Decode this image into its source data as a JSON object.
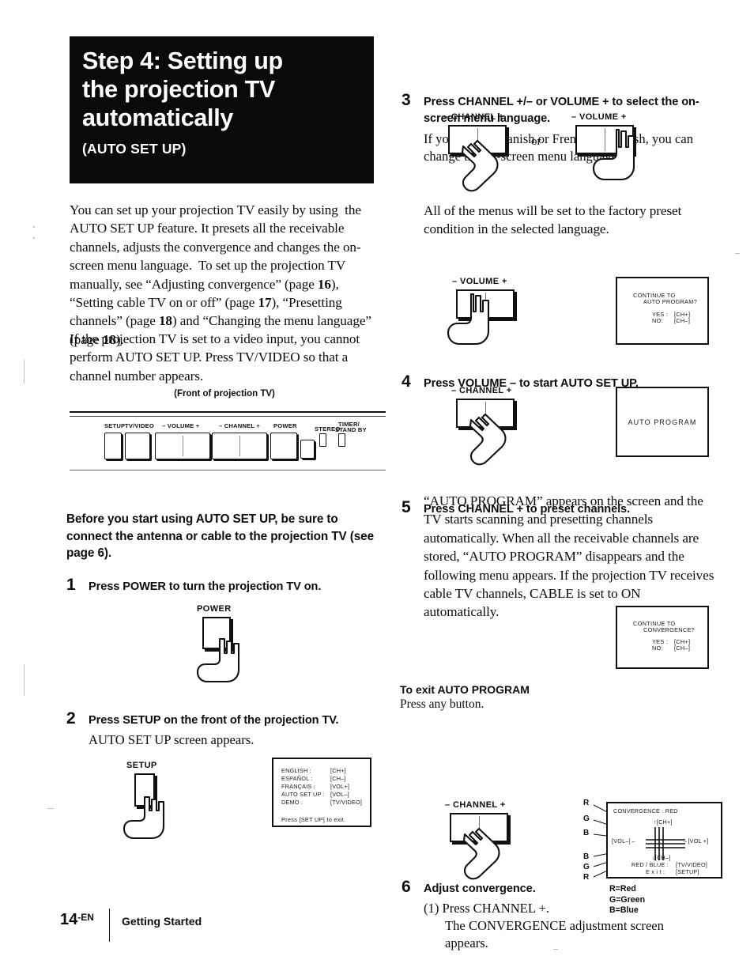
{
  "document": {
    "page_number": "14",
    "page_suffix": "-EN",
    "section": "Getting Started"
  },
  "title": {
    "line1": "Step 4: Setting up",
    "line2": "the projection TV",
    "line3": "automatically",
    "subtitle": "(AUTO SET UP)"
  },
  "intro": {
    "paragraph1": "You can set up your projection TV easily by using  the AUTO SET UP feature. It presets all the receivable channels, adjusts the convergence and changes the on-screen menu language.  To set up the projection TV manually, see “Adjusting convergence” (page 16), “Setting cable TV on or off” (page 17), “Presetting channels” (page 18) and “Changing the menu language” (page 18).",
    "paragraph2": "If the projection TV is set to a video input, you cannot perform AUTO SET UP.  Press TV/VIDEO so that a channel number appears.",
    "page_refs": [
      "16",
      "17",
      "18",
      "18"
    ]
  },
  "front_panel": {
    "caption": "(Front of projection TV)",
    "labels": [
      "SETUP",
      "TV/VIDEO",
      "– VOLUME +",
      "– CHANNEL +",
      "POWER",
      "STEREO",
      "TIMER/",
      "STAND BY"
    ]
  },
  "notice": {
    "text": "Before you start using AUTO SET UP, be sure to connect the antenna or cable to the projection TV (see page 6)."
  },
  "steps": [
    {
      "number": "1",
      "heading": "Press POWER to turn the projection TV on.",
      "figure_label": "POWER"
    },
    {
      "number": "2",
      "heading": "Press SETUP on the front of the projection TV.",
      "body": "AUTO SET UP screen appears.",
      "figure_label": "SETUP"
    },
    {
      "number": "3",
      "heading": "Press CHANNEL +/– or VOLUME + to select the on-screen menu language.",
      "body": "If you prefer Spanish or French to English, you can change the on-screen menu language.",
      "figure_label_left": "– CHANNEL +",
      "figure_conjunction": "or",
      "figure_label_right": "– VOLUME +",
      "note": "All of the menus will be set to the factory preset condition in the selected language."
    },
    {
      "number": "4",
      "heading": "Press VOLUME – to start AUTO SET UP.",
      "figure_label": "– VOLUME +"
    },
    {
      "number": "5",
      "heading": "Press CHANNEL + to preset channels.",
      "figure_label": "– CHANNEL +",
      "body": "“AUTO PROGRAM” appears on the screen and the TV starts scanning and presetting channels automatically.  When all the receivable channels are stored, “AUTO PROGRAM” disappears and the following menu appears.  If the projection TV receives cable TV channels, CABLE is set to ON automatically."
    },
    {
      "number": "6",
      "heading": "Adjust convergence.",
      "sub1": "(1) Press CHANNEL +.",
      "sub1_body_line1": "The CONVERGENCE adjustment screen",
      "sub1_body_line2": "appears.",
      "figure_label": "– CHANNEL +"
    }
  ],
  "exit_note": {
    "heading": "To exit AUTO PROGRAM",
    "body": "Press any button."
  },
  "screens": {
    "setup_menu": {
      "rows": [
        {
          "label": "ENGLISH :",
          "value": "[CH+]"
        },
        {
          "label": "ESPAÑOL :",
          "value": "[CH–]"
        },
        {
          "label": "FRANÇAIS :",
          "value": "[VOL+]"
        },
        {
          "label": "AUTO SET UP :",
          "value": "[VOL–]"
        },
        {
          "label": "DEMO :",
          "value": "[TV/VIDEO]"
        }
      ],
      "footer": "Press   [SET UP]  to  exit."
    },
    "continue_auto_program": {
      "line1": "CONTINUE  TO",
      "line2": "AUTO  PROGRAM?",
      "yes_label": "YES :",
      "yes_value": "[CH+]",
      "no_label": "NO:",
      "no_value": "[CH–]"
    },
    "auto_program": {
      "text": "AUTO  PROGRAM"
    },
    "continue_convergence": {
      "line1": "CONTINUE  TO",
      "line2": "CONVERGENCE?",
      "yes_label": "YES :",
      "yes_value": "[CH+]",
      "no_label": "NO:",
      "no_value": "[CH–]"
    },
    "convergence": {
      "title": "CONVERGENCE   : RED",
      "up": "↑[CH+]",
      "down": "↓[CH–]",
      "left": "[VOL–]←",
      "right": "→[VOL +]",
      "red_blue": "RED / BLUE :",
      "red_blue_value": "[TV/VIDEO]",
      "exit": "E x i t :",
      "exit_value": "[SETUP]",
      "callouts_top": [
        "R",
        "G",
        "B"
      ],
      "callouts_bottom": [
        "B",
        "G",
        "R"
      ],
      "legend": [
        "R=Red",
        "G=Green",
        "B=Blue"
      ]
    }
  }
}
